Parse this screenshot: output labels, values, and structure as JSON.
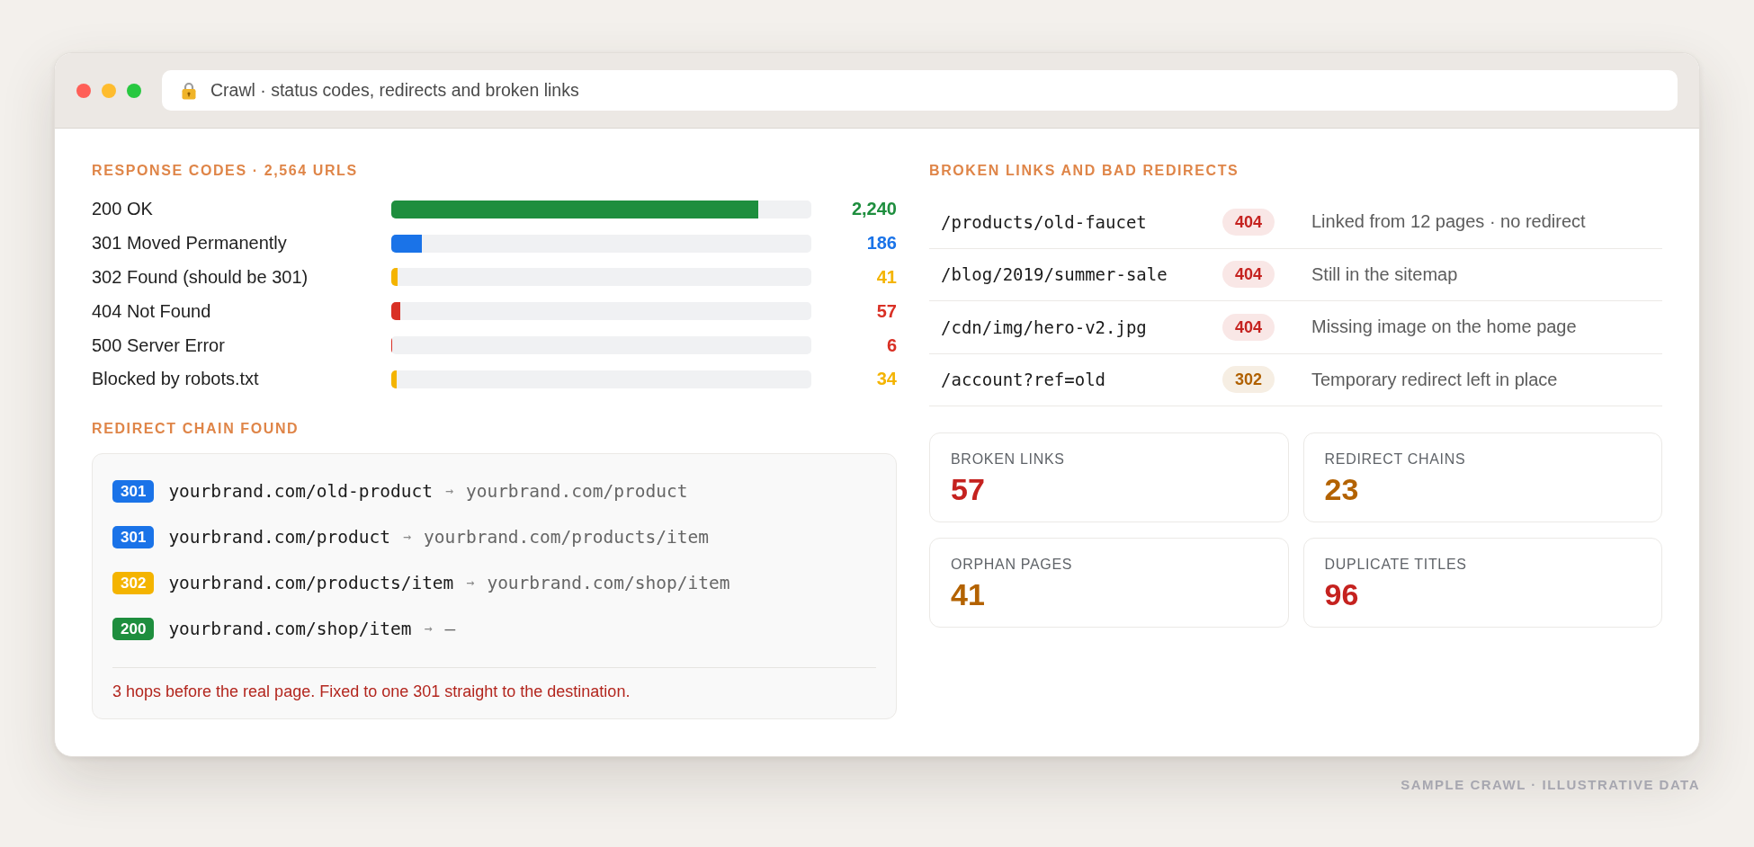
{
  "window": {
    "title": "Crawl · status codes, redirects and broken links"
  },
  "response_codes": {
    "heading": "RESPONSE CODES · 2,564 URLS",
    "rows": [
      {
        "label": "200 OK",
        "level": 0.874,
        "count": "2,240",
        "color": "#1e8e3e"
      },
      {
        "label": "301 Moved Permanently",
        "level": 0.073,
        "count": "186",
        "color": "#1a73e8"
      },
      {
        "label": "302 Found (should be 301)",
        "level": 0.016,
        "count": "41",
        "color": "#f4b400"
      },
      {
        "label": "404 Not Found",
        "level": 0.022,
        "count": "57",
        "color": "#d93025"
      },
      {
        "label": "500 Server Error",
        "level": 0.0023,
        "count": "6",
        "color": "#d93025"
      },
      {
        "label": "Blocked by robots.txt",
        "level": 0.013,
        "count": "34",
        "color": "#f4b400"
      }
    ]
  },
  "redirect_chain": {
    "heading": "REDIRECT CHAIN FOUND",
    "hops": [
      {
        "code": "301",
        "color": "#1a73e8",
        "from": "yourbrand.com/old-product",
        "arrow": "→",
        "to": "yourbrand.com/product"
      },
      {
        "code": "301",
        "color": "#1a73e8",
        "from": "yourbrand.com/product",
        "arrow": "→",
        "to": "yourbrand.com/products/item"
      },
      {
        "code": "302",
        "color": "#f4b400",
        "from": "yourbrand.com/products/item",
        "arrow": "→",
        "to": "yourbrand.com/shop/item"
      },
      {
        "code": "200",
        "color": "#1e8e3e",
        "from": "yourbrand.com/shop/item",
        "arrow": "→",
        "to": "—"
      }
    ],
    "note": "3 hops before the real page. Fixed to one 301 straight to the destination."
  },
  "broken_links": {
    "heading": "BROKEN LINKS AND BAD REDIRECTS",
    "rows": [
      {
        "path": "/products/old-faucet",
        "code": "404",
        "color": "#c5221f",
        "description": "Linked from 12 pages · no redirect"
      },
      {
        "path": "/blog/2019/summer-sale",
        "code": "404",
        "color": "#c5221f",
        "description": "Still in the sitemap"
      },
      {
        "path": "/cdn/img/hero-v2.jpg",
        "code": "404",
        "color": "#c5221f",
        "description": "Missing image on the home page"
      },
      {
        "path": "/account?ref=old",
        "code": "302",
        "color": "#b06000",
        "description": "Temporary redirect left in place"
      }
    ]
  },
  "stats": [
    {
      "label": "BROKEN LINKS",
      "value": "57",
      "color": "#c5221f"
    },
    {
      "label": "REDIRECT CHAINS",
      "value": "23",
      "color": "#b36200"
    },
    {
      "label": "ORPHAN PAGES",
      "value": "41",
      "color": "#b36200"
    },
    {
      "label": "DUPLICATE TITLES",
      "value": "96",
      "color": "#c5221f"
    }
  ],
  "caption": "SAMPLE CRAWL · ILLUSTRATIVE DATA"
}
